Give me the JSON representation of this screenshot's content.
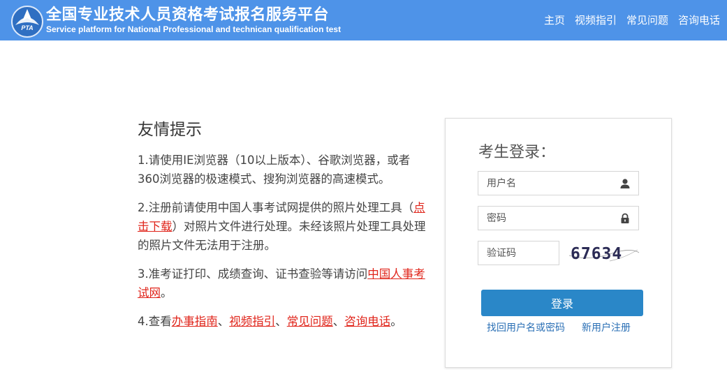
{
  "header": {
    "title_cn": "全国专业技术人员资格考试报名服务平台",
    "title_en": "Service platform for National Professional and technican qualification test",
    "logo_text": "PTA",
    "nav": [
      "主页",
      "视频指引",
      "常见问题",
      "咨询电话"
    ]
  },
  "tips": {
    "heading": "友情提示",
    "tip1": "1.请使用IE浏览器（10以上版本）、谷歌浏览器，或者360浏览器的极速模式、搜狗浏览器的高速模式。",
    "tip2_pre": "2.注册前请使用中国人事考试网提供的照片处理工具（",
    "tip2_link": "点击下载",
    "tip2_post": "）对照片文件进行处理。未经该照片处理工具处理的照片文件无法用于注册。",
    "tip3_pre": "3.准考证打印、成绩查询、证书查验等请访问",
    "tip3_link": "中国人事考试网",
    "tip3_post": "。",
    "tip4_pre": "4.查看",
    "tip4_links": [
      "办事指南",
      "视频指引",
      "常见问题",
      "咨询电话"
    ],
    "tip4_sep": "、",
    "tip4_post": "。"
  },
  "login": {
    "title": "考生登录：",
    "username_placeholder": "用户名",
    "password_placeholder": "密码",
    "captcha_placeholder": "验证码",
    "captcha_text": "67634",
    "submit_label": "登录",
    "forgot_label": "找回用户名或密码",
    "register_label": "新用户注册"
  },
  "icons": {
    "logo": "pta-logo-icon",
    "user": "user-icon",
    "lock": "lock-icon"
  },
  "colors": {
    "header_bg": "#4e93e8",
    "button_bg": "#2a87c8",
    "link_red": "#e0251b",
    "link_blue": "#2a6fb5"
  }
}
